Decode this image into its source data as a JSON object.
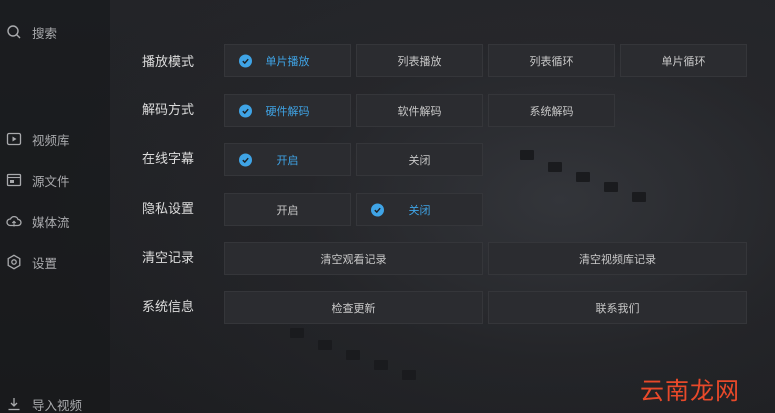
{
  "sidebar": {
    "search_label": "搜索",
    "items": [
      {
        "label": "视频库",
        "icon": "video-library-icon"
      },
      {
        "label": "源文件",
        "icon": "folder-icon"
      },
      {
        "label": "媒体流",
        "icon": "cloud-icon"
      },
      {
        "label": "设置",
        "icon": "gear-icon"
      }
    ],
    "import_label": "导入视频"
  },
  "settings": {
    "playback_mode": {
      "label": "播放模式",
      "options": [
        "单片播放",
        "列表播放",
        "列表循环",
        "单片循环"
      ],
      "selected": "单片播放"
    },
    "decode_mode": {
      "label": "解码方式",
      "options": [
        "硬件解码",
        "软件解码",
        "系统解码"
      ],
      "selected": "硬件解码"
    },
    "online_subtitles": {
      "label": "在线字幕",
      "options": [
        "开启",
        "关闭"
      ],
      "selected": "开启"
    },
    "privacy": {
      "label": "隐私设置",
      "options": [
        "开启",
        "关闭"
      ],
      "selected": "关闭"
    },
    "clear_records": {
      "label": "清空记录",
      "actions": [
        "清空观看记录",
        "清空视频库记录"
      ]
    },
    "system_info": {
      "label": "系统信息",
      "actions": [
        "检查更新",
        "联系我们"
      ]
    }
  },
  "colors": {
    "accent": "#3fa4e6",
    "background": "#1f2023",
    "button": "#2b2c30",
    "watermark": "#e8492a"
  },
  "watermark": "云南龙网"
}
